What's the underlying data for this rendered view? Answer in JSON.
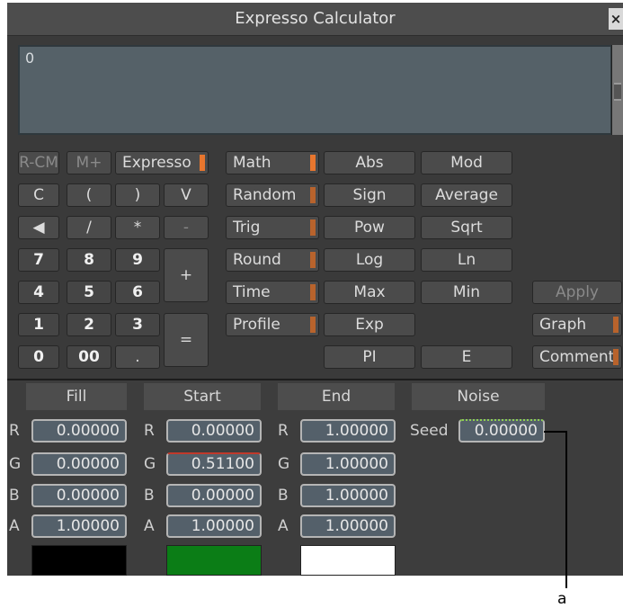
{
  "window": {
    "title": "Expresso Calculator",
    "close_glyph": "×"
  },
  "display": {
    "value": "0"
  },
  "memory": {
    "rcm": "R-CM",
    "mplus": "M+"
  },
  "modes": {
    "expresso": "Expresso",
    "math": "Math",
    "random": "Random",
    "trig": "Trig",
    "round": "Round",
    "time": "Time",
    "profile": "Profile"
  },
  "keypad": {
    "c": "C",
    "lparen": "(",
    "rparen": ")",
    "v": "V",
    "backspace": "◀",
    "divide": "/",
    "multiply": "*",
    "minus": "-",
    "seven": "7",
    "eight": "8",
    "nine": "9",
    "plus": "+",
    "four": "4",
    "five": "5",
    "six": "6",
    "one": "1",
    "two": "2",
    "three": "3",
    "equals": "=",
    "zero": "0",
    "double_zero": "00",
    "dot": "."
  },
  "functions": {
    "abs": "Abs",
    "mod": "Mod",
    "sign": "Sign",
    "average": "Average",
    "pow": "Pow",
    "sqrt": "Sqrt",
    "log": "Log",
    "ln": "Ln",
    "max": "Max",
    "min": "Min",
    "exp": "Exp",
    "pi": "PI",
    "e": "E"
  },
  "actions": {
    "apply": "Apply",
    "graph": "Graph",
    "comment": "Comment"
  },
  "colors": {
    "fill": {
      "header": "Fill",
      "r": "0.00000",
      "g": "0.00000",
      "b": "0.00000",
      "a": "1.00000",
      "swatch": "#000000"
    },
    "start": {
      "header": "Start",
      "r": "0.00000",
      "g": "0.51100",
      "b": "0.00000",
      "a": "1.00000",
      "swatch": "#0b7d16"
    },
    "end": {
      "header": "End",
      "r": "1.00000",
      "g": "1.00000",
      "b": "1.00000",
      "a": "1.00000",
      "swatch": "#ffffff"
    }
  },
  "channel_labels": {
    "r": "R",
    "g": "G",
    "b": "B",
    "a": "A"
  },
  "noise": {
    "header": "Noise",
    "seed_label": "Seed",
    "seed_value": "0.00000"
  },
  "callout": {
    "label": "a"
  },
  "accent_color": "#e8762e"
}
